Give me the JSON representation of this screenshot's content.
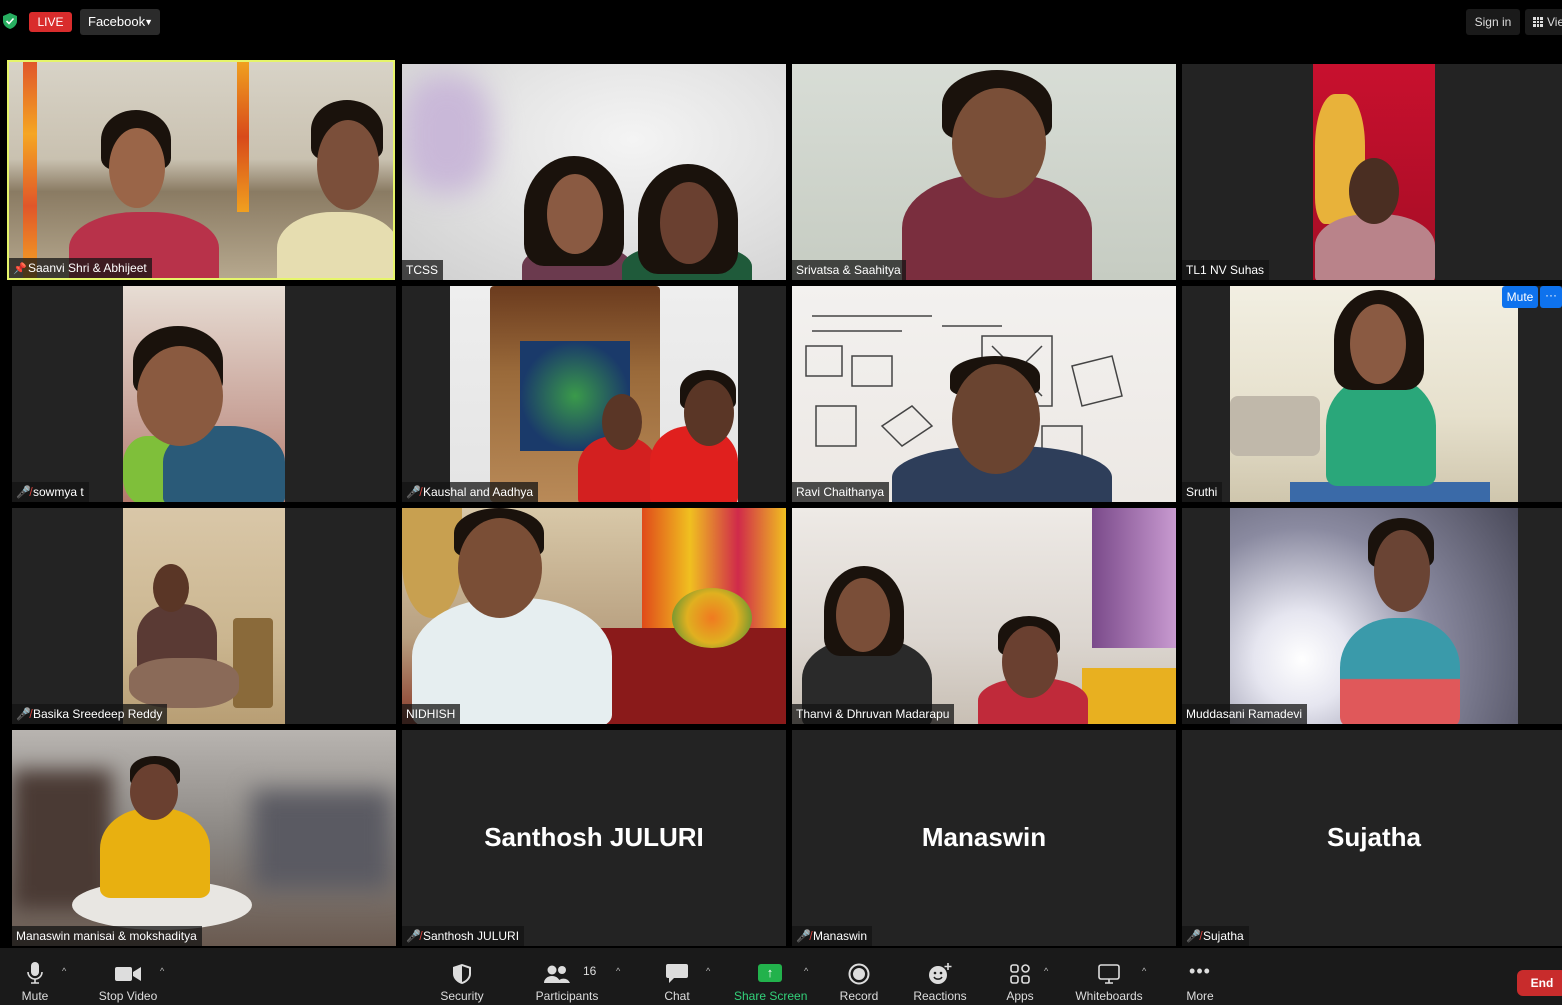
{
  "top_bar": {
    "live_label": "LIVE",
    "stream_target": "Facebook",
    "sign_in": "Sign in",
    "view": "View"
  },
  "participants": [
    {
      "name": "Saanvi Shri & Abhijeet",
      "status": "pinned",
      "active_speaker": true
    },
    {
      "name": "TCSS",
      "status": "none"
    },
    {
      "name": "Srivatsa & Saahitya",
      "status": "none"
    },
    {
      "name": "TL1 NV Suhas",
      "status": "none"
    },
    {
      "name": "sowmya t",
      "status": "muted"
    },
    {
      "name": "Kaushal and Aadhya",
      "status": "muted"
    },
    {
      "name": "Ravi Chaithanya",
      "status": "none"
    },
    {
      "name": "Sruthi",
      "status": "none",
      "mute_button": "Mute",
      "more_button": "···"
    },
    {
      "name": "Basika Sreedeep Reddy",
      "status": "muted"
    },
    {
      "name": "NIDHISH",
      "status": "none"
    },
    {
      "name": "Thanvi & Dhruvan Madarapu",
      "status": "none"
    },
    {
      "name": "Muddasani Ramadevi",
      "status": "none"
    },
    {
      "name": "Manaswin manisai  & mokshaditya",
      "status": "none"
    },
    {
      "name": "Santhosh JULURI",
      "status": "muted",
      "video_off": true,
      "display": "Santhosh JULURI"
    },
    {
      "name": "Manaswin",
      "status": "muted",
      "video_off": true,
      "display": "Manaswin"
    },
    {
      "name": "Sujatha",
      "status": "muted",
      "video_off": true,
      "display": "Sujatha"
    }
  ],
  "toolbar": {
    "mute": "Mute",
    "stop_video": "Stop Video",
    "security": "Security",
    "participants": "Participants",
    "participant_count": "16",
    "chat": "Chat",
    "share_screen": "Share Screen",
    "record": "Record",
    "reactions": "Reactions",
    "apps": "Apps",
    "whiteboards": "Whiteboards",
    "more": "More",
    "end": "End"
  },
  "colors": {
    "live_red": "#d92c2c",
    "active_speaker": "#e6f56a",
    "share_green": "#22b24c",
    "muted_icon": "#e0423c",
    "accent_blue": "#0e72ed",
    "end_red": "#c82c2c"
  },
  "icons": [
    "shield-icon",
    "grid-icon",
    "pin-icon",
    "mic-off-icon",
    "mic-icon",
    "camera-icon",
    "security-icon",
    "participants-icon",
    "chat-icon",
    "share-screen-icon",
    "record-icon",
    "reactions-icon",
    "apps-icon",
    "whiteboards-icon",
    "more-icon"
  ]
}
